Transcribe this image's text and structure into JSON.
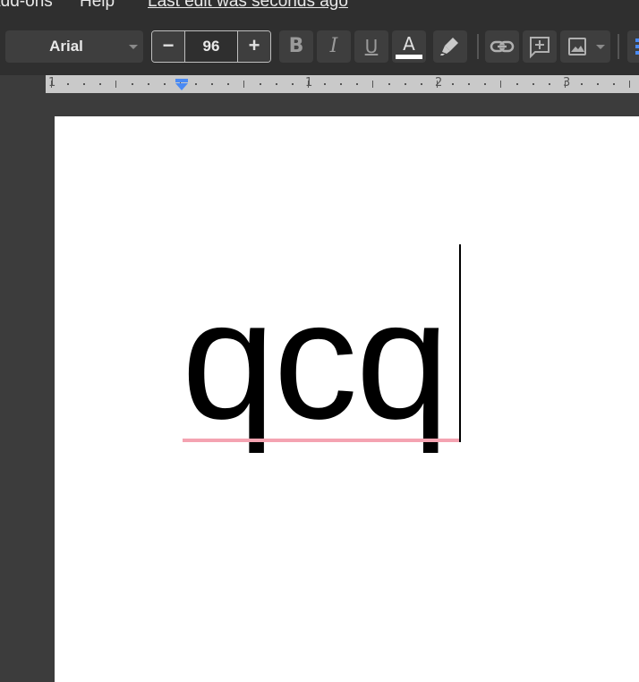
{
  "menubar": {
    "items": [
      {
        "label": "Add-ons"
      },
      {
        "label": "Help"
      }
    ],
    "last_edit": "Last edit was seconds ago"
  },
  "toolbar": {
    "font_family": "Arial",
    "font_size": "96",
    "decrease_label": "−",
    "increase_label": "+",
    "bold_label": "B",
    "italic_label": "I",
    "underline_label": "U",
    "text_color_label": "A",
    "text_color": "#ffffff",
    "icons": [
      "highlighter-icon",
      "link-icon",
      "add-comment-icon",
      "image-icon",
      "list-icon"
    ]
  },
  "ruler": {
    "labels": [
      "1",
      "1",
      "2",
      "3"
    ]
  },
  "document": {
    "text": "qcq",
    "spellcheck_color": "#f4a3b1"
  }
}
